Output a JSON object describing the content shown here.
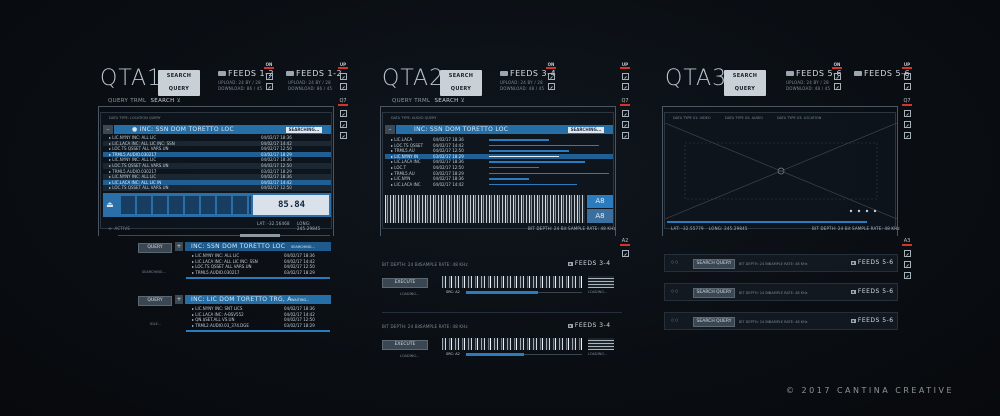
{
  "panels": {
    "qta1": {
      "title": "QTA1",
      "search_query": "SEARCH QUERY",
      "feeds": "FEEDS 1-2",
      "on": "ON",
      "upload": "UPLOAD: 24 BY / 28",
      "download": "DOWNLOAD: 86 / 45",
      "query_label": "QUERY TRML",
      "query_value": "SEARCH",
      "data_type": "DATA TYPE: LOCATION QUERY",
      "inc": "INC: SSN DOM TORETTO LOC",
      "searching": "SEARCHING...",
      "rows": [
        {
          "name": "LIC.NYNY INC: ALL LIC",
          "date": "04/02/17 18:36"
        },
        {
          "name": "LIC.LACA INC: ALL LIC INC: SSN",
          "date": "04/02/17 14:42"
        },
        {
          "name": "LOC.TS QSSET ALL VARS.UN",
          "date": "04/02/17 12:50"
        },
        {
          "name": "TRML5.AUDIO.030217",
          "date": "03/02/17 18:29"
        },
        {
          "name": "LIC.NYNY INC: ALL LIC",
          "date": "04/02/17 18:36"
        },
        {
          "name": "LOC.TS QSSET ALL VARS.UN",
          "date": "04/02/17 12:50"
        },
        {
          "name": "TRML5.AUDIO.030217",
          "date": "03/02/17 18:29"
        },
        {
          "name": "LIC.NYNY INC: ALL LIC",
          "date": "04/02/17 18:36"
        },
        {
          "name": "LIC.LACA INC: ALL LIC IN",
          "date": "04/02/17 14:42"
        },
        {
          "name": "LOC.TS QSSET ALL VARS.UN",
          "date": "04/02/17 12:50"
        }
      ],
      "metric": "85.84",
      "lat": "LAT: -32.56468",
      "long": "LONG: 245.29845",
      "active": "ACTIVE",
      "q7": "Q7",
      "up": "UP",
      "sub": [
        {
          "query": "QUERY",
          "inc": "INC: SSN DOM TORETTO LOC",
          "status": "SEARCHING...",
          "side": "SEARCHING...",
          "rows": [
            {
              "name": "LIC.NYNY INC: ALL LIC",
              "date": "04/02/17 18:36"
            },
            {
              "name": "LIC.LACA INC: ALL LIC INC: SSN",
              "date": "04/02/17 14:42"
            },
            {
              "name": "LOC.TS QSSET ALL VARS.UN",
              "date": "04/02/17 12:50"
            },
            {
              "name": "TRML5.AUDIO.030217",
              "date": "03/02/17 18:29"
            }
          ]
        },
        {
          "query": "QUERY",
          "inc": "INC: LIC DOM TORETTO TRG, A",
          "status": "WAITING...",
          "side": "IDLE...",
          "rows": [
            {
              "name": "LIC.NYNY INC: SNT LICS",
              "date": "04/02/17 18:36"
            },
            {
              "name": "LIC.LACA INC: A-BSV552",
              "date": "04/02/17 14:42"
            },
            {
              "name": "QN.$SET.ALL VS.UN",
              "date": "04/02/17 12:50"
            },
            {
              "name": "TRML2.AUDIO.03_374.DGE",
              "date": "03/02/17 18:29"
            }
          ]
        }
      ]
    },
    "qta2": {
      "title": "QTA2",
      "search_query": "SEARCH QUERY",
      "feeds": "FEEDS 3-4",
      "on": "ON",
      "upload": "UPLOAD: 24 BY / 28",
      "download": "DOWNLOAD: 48 / 45",
      "query_label": "QUERY TRML",
      "query_value": "SEARCH",
      "data_type": "DATA TYPE: AUDIO QUERY",
      "inc": "INC: SSN DOM TORETTO LOC",
      "searching": "SEARCHING...",
      "rows": [
        {
          "name": "LIC.LACA",
          "date": "04/02/17 18:36"
        },
        {
          "name": "LOC.TS QSSET",
          "date": "04/02/17 14:42"
        },
        {
          "name": "TRML5.AU",
          "date": "04/02/17 12:50"
        },
        {
          "name": "LIC.NYNY IN",
          "date": "03/02/17 18:29"
        },
        {
          "name": "LIC.LACA INC",
          "date": "04/02/17 18:36"
        },
        {
          "name": "LOC.T",
          "date": "04/02/17 12:50"
        },
        {
          "name": "TRML5.AU",
          "date": "03/02/17 18:29"
        },
        {
          "name": "LIC.NYN",
          "date": "04/02/17 18:36"
        },
        {
          "name": "LIC.LACA INC",
          "date": "04/02/17 14:42"
        }
      ],
      "a8": "A8",
      "a8b": "A8",
      "bit_depth": "BIT DEPTH: 24 Bit",
      "sample_rate": "SAMPLE RATE: 48 KHz",
      "q7": "Q7",
      "up": "UP",
      "a2": "A2",
      "sub": [
        {
          "bit": "BIT DEPTH: 24 Bit",
          "rate": "SAMPLE RATE: 48 KHz",
          "feeds": "FEEDS 3-4",
          "execute": "EXECUTE",
          "loading": "LOADING...",
          "src": "SRC: A2",
          "loading2": "LOADING..."
        },
        {
          "bit": "BIT DEPTH: 24 Bit",
          "rate": "SAMPLE RATE: 48 KHz",
          "feeds": "FEEDS 3-4",
          "execute": "EXECUTE",
          "loading": "LOADING...",
          "src": "SRC: A2",
          "loading2": "LOADING..."
        }
      ]
    },
    "qta3": {
      "title": "QTA3",
      "search_query": "SEARCH QUERY",
      "feeds": "FEEDS 5-6",
      "on": "ON",
      "upload": "UPLOAD: 24 BY / 28",
      "download": "DOWNLOAD: 48 / 45",
      "data_type_1": "DATA TYPE 01: VIDEO",
      "data_type_2": "DATA TYPE 02: AUDIO",
      "data_type_3": "DATA TYPE 03: LOCATION",
      "lat": "LAT: -32.55779",
      "long": "LONG: 245.29845",
      "bit_depth": "BIT DEPTH: 24 Bit",
      "sample_rate": "SAMPLE RATE: 48 KHz",
      "q7": "Q7",
      "up": "UP",
      "a3": "A3",
      "sub": [
        {
          "query": "SEARCH QUERY",
          "bit": "BIT DEPTH: 24 Bit",
          "rate": "SAMPLE RATE: 48 KHz",
          "feeds": "FEEDS 5-6"
        },
        {
          "query": "SEARCH QUERY",
          "bit": "BIT DEPTH: 24 Bit",
          "rate": "SAMPLE RATE: 48 KHz",
          "feeds": "FEEDS 5-6"
        },
        {
          "query": "SEARCH QUERY",
          "bit": "BIT DEPTH: 24 Bit",
          "rate": "SAMPLE RATE: 48 KHz",
          "feeds": "FEEDS 5-6"
        }
      ]
    }
  },
  "copyright": "© 2017  CANTINA CREATIVE",
  "colors": {
    "accent": "#2b7bbf",
    "alert": "#d2332e",
    "background": "#0a0e13"
  }
}
